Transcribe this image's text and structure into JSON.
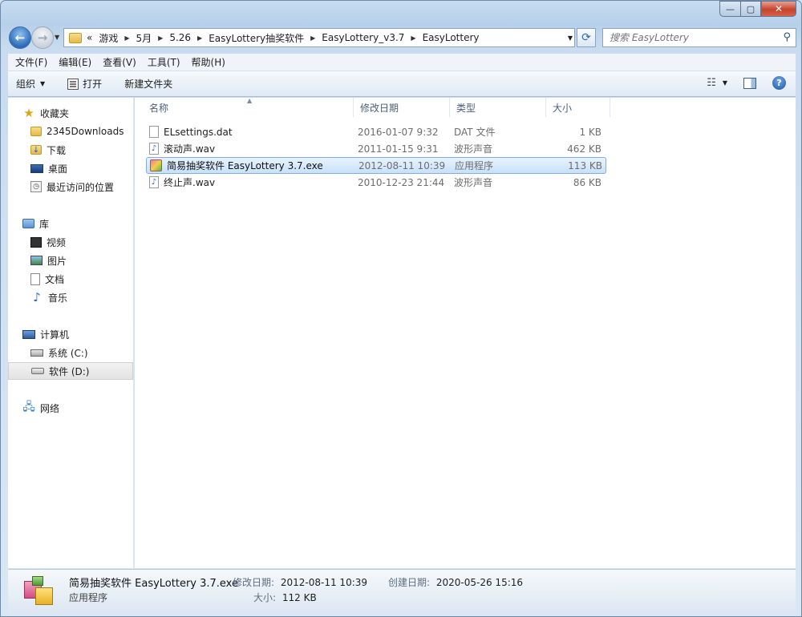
{
  "window": {
    "caption": {
      "minimize": "—",
      "maximize": "▢",
      "close": "✕"
    }
  },
  "nav": {
    "back": "←",
    "forward": "→",
    "address": {
      "overflow": "«",
      "crumbs": [
        "游戏",
        "5月",
        "5.26",
        "EasyLottery抽奖软件",
        "EasyLottery_v3.7",
        "EasyLottery"
      ]
    },
    "search_placeholder": "搜索 EasyLottery"
  },
  "menubar": [
    "文件(F)",
    "编辑(E)",
    "查看(V)",
    "工具(T)",
    "帮助(H)"
  ],
  "toolbar": {
    "organize": "组织",
    "open": "打开",
    "new_folder": "新建文件夹"
  },
  "sidebar": {
    "favorites": {
      "label": "收藏夹",
      "items": [
        "2345Downloads",
        "下载",
        "桌面",
        "最近访问的位置"
      ]
    },
    "libraries": {
      "label": "库",
      "items": [
        "视频",
        "图片",
        "文档",
        "音乐"
      ]
    },
    "computer": {
      "label": "计算机",
      "items": [
        "系统 (C:)",
        "软件 (D:)"
      ]
    },
    "network": {
      "label": "网络"
    }
  },
  "columns": [
    "名称",
    "修改日期",
    "类型",
    "大小"
  ],
  "files": [
    {
      "name": "ELsettings.dat",
      "date": "2016-01-07 9:32",
      "type": "DAT 文件",
      "size": "1 KB",
      "icon": "file-icon"
    },
    {
      "name": "滚动声.wav",
      "date": "2011-01-15 9:31",
      "type": "波形声音",
      "size": "462 KB",
      "icon": "wav-icon"
    },
    {
      "name": "简易抽奖软件 EasyLottery 3.7.exe",
      "date": "2012-08-11 10:39",
      "type": "应用程序",
      "size": "113 KB",
      "icon": "exe-icon",
      "selected": true
    },
    {
      "name": "终止声.wav",
      "date": "2010-12-23 21:44",
      "type": "波形声音",
      "size": "86 KB",
      "icon": "wav-icon"
    }
  ],
  "details": {
    "name": "简易抽奖软件 EasyLottery 3.7.exe",
    "type": "应用程序",
    "modified_label": "修改日期:",
    "modified": "2012-08-11 10:39",
    "created_label": "创建日期:",
    "created": "2020-05-26 15:16",
    "size_label": "大小:",
    "size": "112 KB"
  }
}
